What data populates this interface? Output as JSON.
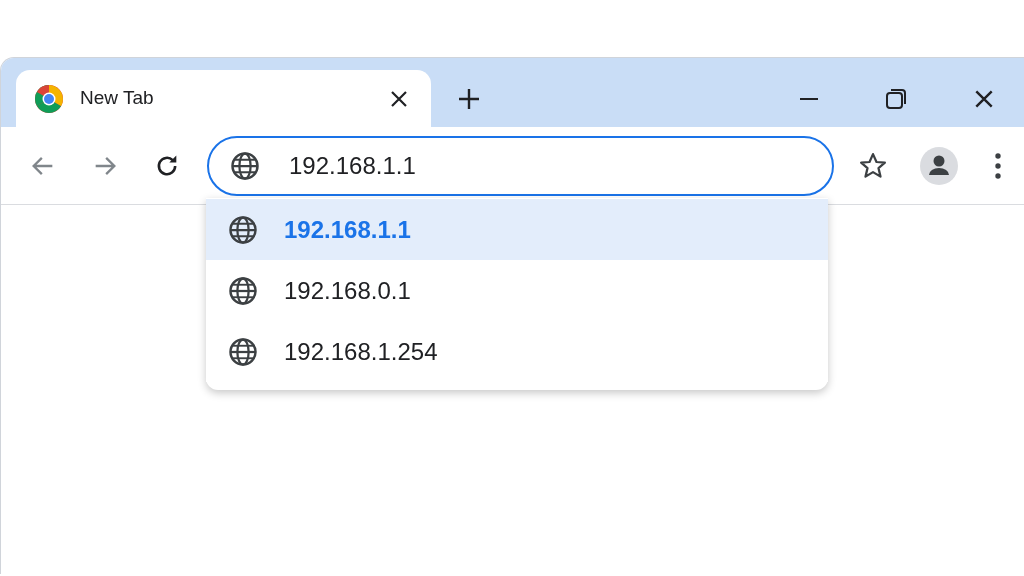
{
  "tabs": [
    {
      "title": "New Tab",
      "selected": true
    }
  ],
  "address_bar": {
    "value": "192.168.1.1"
  },
  "suggestions": [
    {
      "text": "192.168.1.1",
      "selected": true
    },
    {
      "text": "192.168.0.1",
      "selected": false
    },
    {
      "text": "192.168.1.254",
      "selected": false
    }
  ]
}
